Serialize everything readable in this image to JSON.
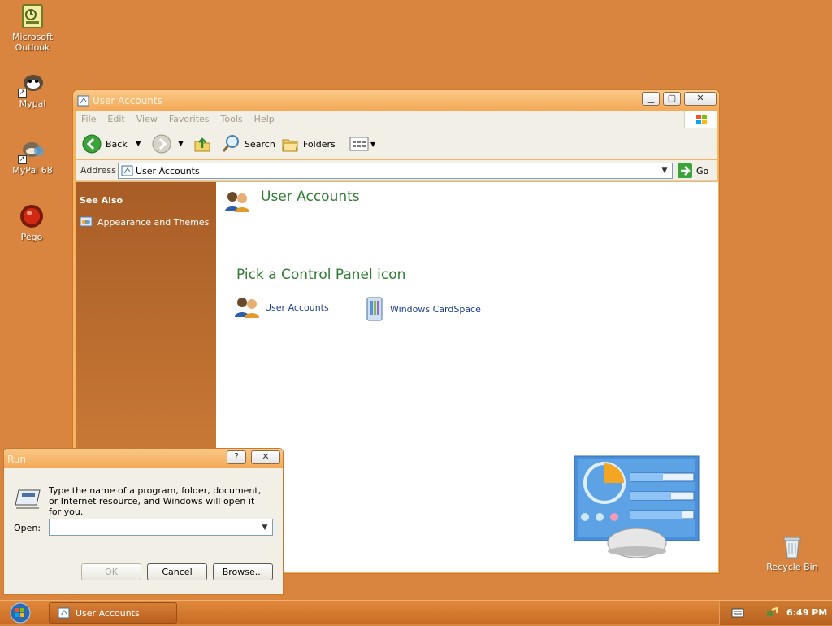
{
  "desktop": {
    "icons": [
      {
        "label": "Microsoft Outlook",
        "icon": "outlook-icon"
      },
      {
        "label": "Mypal",
        "icon": "mypal-icon"
      },
      {
        "label": "MyPal 68",
        "icon": "mypal-68-icon"
      },
      {
        "label": "Pego",
        "icon": "pego-icon"
      },
      {
        "label": "Recycle Bin",
        "icon": "recycle-bin-icon"
      }
    ]
  },
  "window": {
    "title": "User Accounts",
    "menu": [
      "File",
      "Edit",
      "View",
      "Favorites",
      "Tools",
      "Help"
    ],
    "toolbar": {
      "back": "Back",
      "search": "Search",
      "folders": "Folders"
    },
    "address": {
      "label": "Address",
      "value": "User Accounts",
      "go": "Go"
    },
    "sidebar": {
      "heading": "See Also",
      "links": [
        "Appearance and Themes"
      ]
    },
    "content": {
      "title": "User Accounts",
      "subtitle": "Pick a Control Panel icon",
      "items": [
        "User Accounts",
        "Windows CardSpace"
      ]
    }
  },
  "run_dialog": {
    "title": "Run",
    "description": "Type the name of a program, folder, document, or Internet resource, and Windows will open it for you.",
    "open_label": "Open:",
    "open_value": "",
    "ok": "OK",
    "cancel": "Cancel",
    "browse": "Browse..."
  },
  "taskbar": {
    "task": "User Accounts",
    "clock": "6:49 PM"
  },
  "colors": {
    "desktop": "#d9843f",
    "accent_green": "#2e7d32",
    "link_blue": "#1a3f8c"
  }
}
